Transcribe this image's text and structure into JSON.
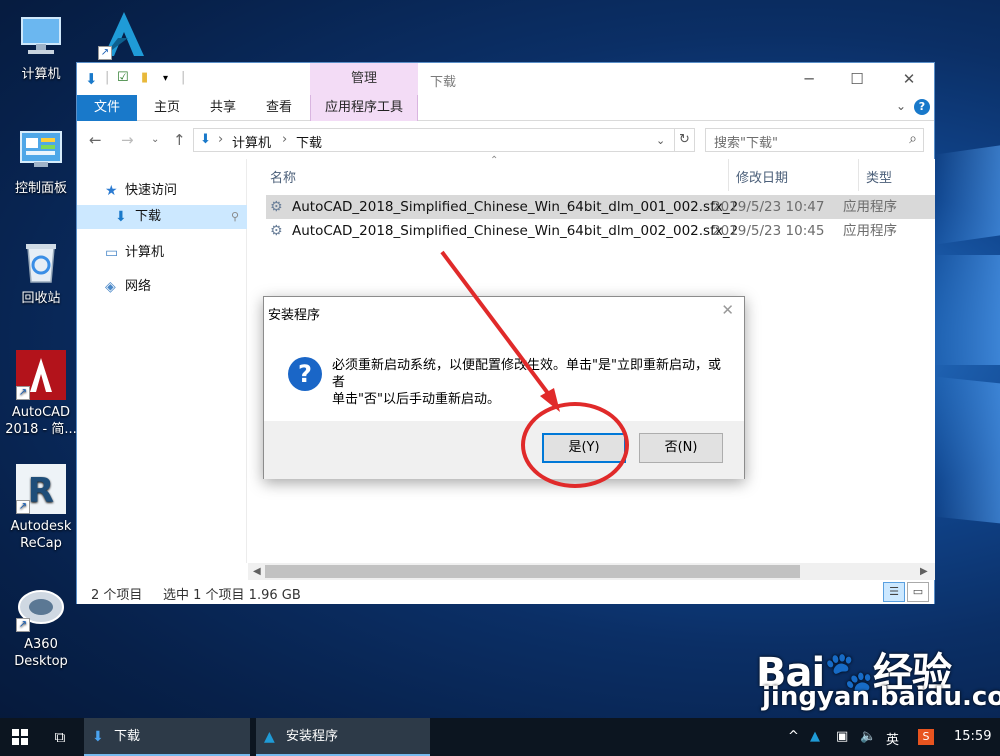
{
  "desktop": {
    "icons": [
      {
        "label": "计算机"
      },
      {
        "label": "控制面板"
      },
      {
        "label": "回收站"
      },
      {
        "label": "AutoCAD 2018 - 简..."
      },
      {
        "label": "Autodesk ReCap"
      },
      {
        "label": "A360 Desktop"
      }
    ]
  },
  "explorer": {
    "title": "下载",
    "context_tab_header": "管理",
    "ribbon_tabs": [
      "文件",
      "主页",
      "共享",
      "查看",
      "应用程序工具"
    ],
    "address": {
      "segments": [
        "计算机",
        "下载"
      ]
    },
    "search_placeholder": "搜索\"下载\"",
    "nav": {
      "quick_access": "快速访问",
      "downloads": "下载",
      "computer": "计算机",
      "network": "网络"
    },
    "columns": {
      "name": "名称",
      "date": "修改日期",
      "type": "类型"
    },
    "files": [
      {
        "name": "AutoCAD_2018_Simplified_Chinese_Win_64bit_dlm_001_002.sfx_2",
        "date": "2019/5/23 10:47",
        "type": "应用程序",
        "selected": true
      },
      {
        "name": "AutoCAD_2018_Simplified_Chinese_Win_64bit_dlm_002_002.sfx_2",
        "date": "2019/5/23 10:45",
        "type": "应用程序",
        "selected": false
      }
    ],
    "status": {
      "count": "2 个项目",
      "selection": "选中 1 个项目  1.96 GB"
    }
  },
  "dialog": {
    "title": "安装程序",
    "message_line1": "必须重新启动系统，以便配置修改生效。单击\"是\"立即重新启动，或者",
    "message_line2": "单击\"否\"以后手动重新启动。",
    "yes_label": "是(Y)",
    "no_label": "否(N)"
  },
  "taskbar": {
    "apps": [
      {
        "label": "下载"
      },
      {
        "label": "安装程序"
      }
    ],
    "ime": "英",
    "clock": "15:59"
  },
  "watermark": {
    "line1": "Bai du 经验",
    "line2": "jingyan.baidu.com"
  },
  "colors": {
    "accent": "#1979ca",
    "context_tab": "#f3dcf6",
    "annotation": "#e02a2a",
    "taskbar": "#0c1520"
  }
}
